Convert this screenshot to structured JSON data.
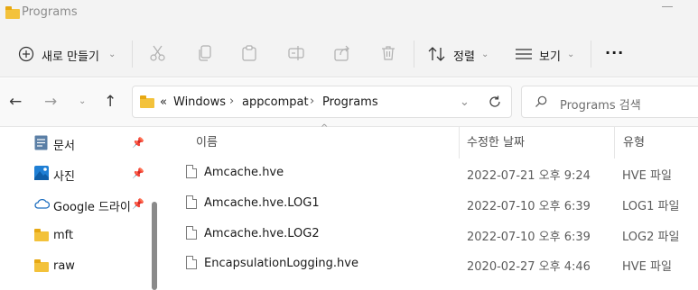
{
  "window": {
    "title": "Programs"
  },
  "toolbar": {
    "new_label": "새로 만들기",
    "sort_label": "정렬",
    "view_label": "보기",
    "more_label": "···"
  },
  "nav": {
    "back_icon": "arrow-left-icon",
    "forward_icon": "arrow-right-icon",
    "recent_icon": "chevron-down-icon",
    "up_icon": "arrow-up-icon"
  },
  "address": {
    "overflow": "«",
    "crumbs": [
      "Windows",
      "appcompat",
      "Programs"
    ]
  },
  "search": {
    "placeholder": "Programs 검색"
  },
  "sidebar": {
    "items": [
      {
        "label": "문서",
        "icon": "documents-icon",
        "pinned": true
      },
      {
        "label": "사진",
        "icon": "pictures-icon",
        "pinned": true
      },
      {
        "label": "Google 드라이",
        "icon": "cloud-icon",
        "pinned": true
      },
      {
        "label": "mft",
        "icon": "folder-icon",
        "pinned": false
      },
      {
        "label": "raw",
        "icon": "folder-icon",
        "pinned": false
      }
    ]
  },
  "columns": {
    "name": "이름",
    "modified": "수정한 날짜",
    "type": "유형"
  },
  "files": [
    {
      "name": "Amcache.hve",
      "modified": "2022-07-21 오후 9:24",
      "type": "HVE 파일"
    },
    {
      "name": "Amcache.hve.LOG1",
      "modified": "2022-07-10 오후 6:39",
      "type": "LOG1 파일"
    },
    {
      "name": "Amcache.hve.LOG2",
      "modified": "2022-07-10 오후 6:39",
      "type": "LOG2 파일"
    },
    {
      "name": "EncapsulationLogging.hve",
      "modified": "2020-02-27 오후 4:46",
      "type": "HVE 파일"
    }
  ],
  "colors": {
    "folder": "#f3c23b",
    "accent": "#0067c0"
  }
}
